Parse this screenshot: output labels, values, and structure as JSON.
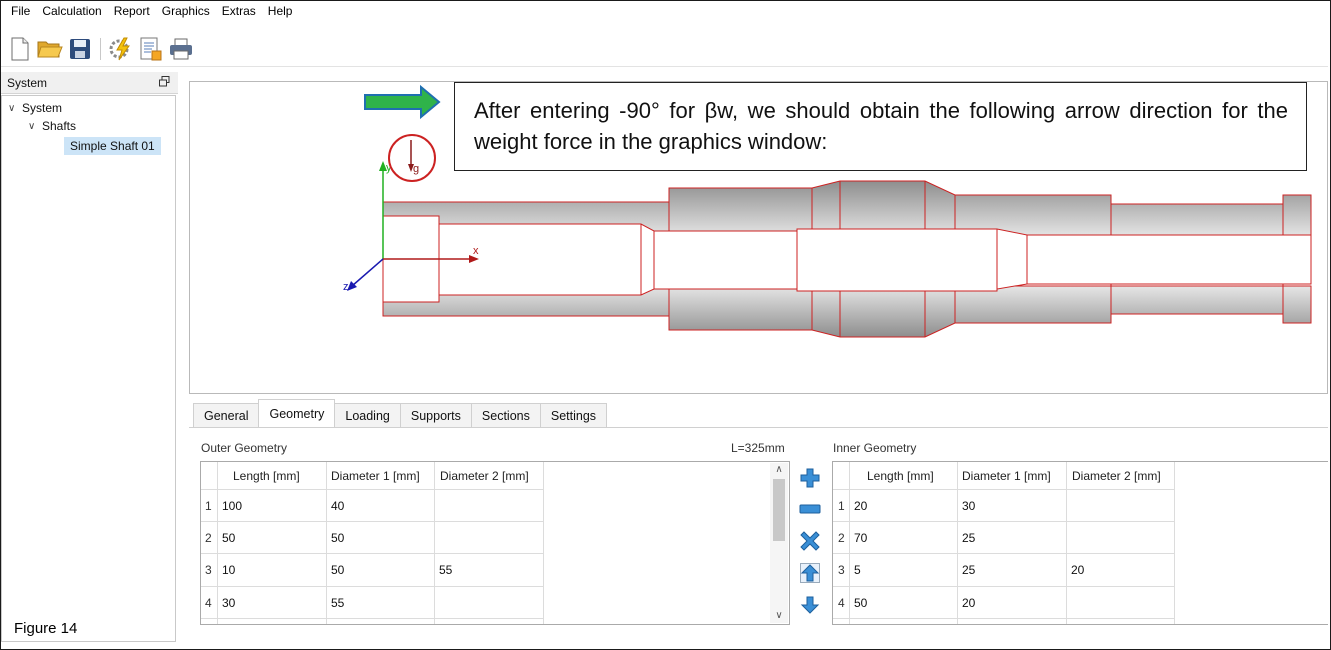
{
  "menu": [
    "File",
    "Calculation",
    "Report",
    "Graphics",
    "Extras",
    "Help"
  ],
  "toolbar": {
    "icons": [
      "new-file-icon",
      "open-folder-icon",
      "save-icon",
      "calculate-icon",
      "report-icon",
      "print-icon"
    ]
  },
  "system_panel": {
    "title": "System",
    "tree": [
      {
        "label": "System",
        "level": 0,
        "expanded": true
      },
      {
        "label": "Shafts",
        "level": 1,
        "expanded": true
      },
      {
        "label": "Simple Shaft 01",
        "level": 2,
        "selected": true
      }
    ]
  },
  "graphics": {
    "callout": "After entering -90° for βw, we should obtain the following arrow direction for the weight force in the graphics window:",
    "axis_x": "x",
    "axis_y": "y",
    "axis_z": "z",
    "weight_label": "g",
    "arrow_color": "#1fa33a"
  },
  "tabs": [
    {
      "label": "General",
      "active": false
    },
    {
      "label": "Geometry",
      "active": true
    },
    {
      "label": "Loading",
      "active": false
    },
    {
      "label": "Supports",
      "active": false
    },
    {
      "label": "Sections",
      "active": false
    },
    {
      "label": "Settings",
      "active": false
    }
  ],
  "outer": {
    "title": "Outer Geometry",
    "total_length": "L=325mm",
    "columns": [
      "Length [mm]",
      "Diameter 1 [mm]",
      "Diameter 2 [mm]"
    ],
    "rows": [
      {
        "n": "1",
        "length": "100",
        "d1": "40",
        "d2": ""
      },
      {
        "n": "2",
        "length": "50",
        "d1": "50",
        "d2": ""
      },
      {
        "n": "3",
        "length": "10",
        "d1": "50",
        "d2": "55"
      },
      {
        "n": "4",
        "length": "30",
        "d1": "55",
        "d2": ""
      }
    ]
  },
  "inner": {
    "title": "Inner Geometry",
    "columns": [
      "Length [mm]",
      "Diameter 1 [mm]",
      "Diameter 2 [mm]"
    ],
    "rows": [
      {
        "n": "1",
        "length": "20",
        "d1": "30",
        "d2": ""
      },
      {
        "n": "2",
        "length": "70",
        "d1": "25",
        "d2": ""
      },
      {
        "n": "3",
        "length": "5",
        "d1": "25",
        "d2": "20"
      },
      {
        "n": "4",
        "length": "50",
        "d1": "20",
        "d2": ""
      }
    ]
  },
  "side_buttons": [
    "add-row-icon",
    "remove-row-icon",
    "clear-icon",
    "move-up-icon",
    "move-down-icon"
  ],
  "figure_label": "Figure 14"
}
